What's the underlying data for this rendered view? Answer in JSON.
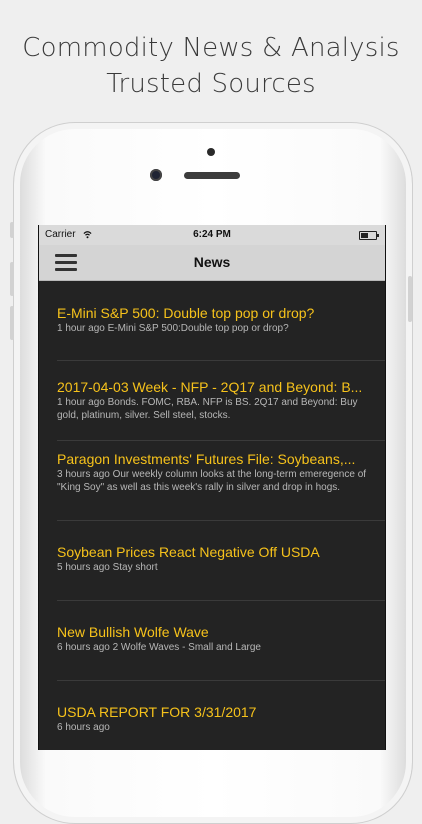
{
  "banner": {
    "line1": "Commodity News & Analysis",
    "line2": "Trusted Sources"
  },
  "status": {
    "carrier": "Carrier",
    "time": "6:24 PM"
  },
  "nav": {
    "title": "News"
  },
  "items": [
    {
      "title": "E-Mini S&P 500: Double top pop or drop?",
      "meta": "1 hour ago E-Mini S&P 500:Double top pop or drop?"
    },
    {
      "title": "2017-04-03 Week - NFP - 2Q17 and Beyond: B...",
      "meta": "1 hour ago Bonds. FOMC, RBA. NFP is BS. 2Q17 and Beyond: Buy gold, platinum, silver. Sell steel, stocks."
    },
    {
      "title": "Paragon Investments' Futures File: Soybeans,...",
      "meta": "3 hours ago Our weekly column looks at the long-term emeregence of \"King Soy\" as well as this week's rally in silver and drop in hogs."
    },
    {
      "title": "Soybean Prices React Negative Off USDA",
      "meta": "5 hours ago Stay short"
    },
    {
      "title": "New Bullish Wolfe Wave",
      "meta": "6 hours ago 2 Wolfe Waves - Small and Large"
    },
    {
      "title": "USDA REPORT FOR 3/31/2017",
      "meta": "6 hours ago"
    }
  ]
}
